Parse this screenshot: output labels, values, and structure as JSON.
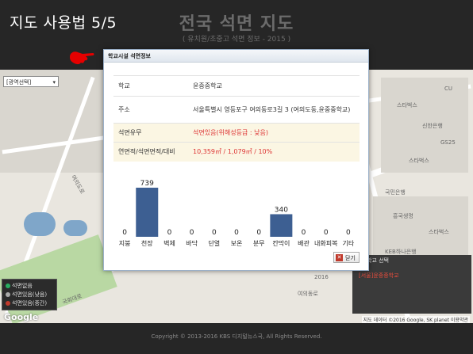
{
  "overlay_title": "지도 사용법 5/5",
  "header": {
    "title": "전국 석면 지도",
    "subtitle": "( 유치원/초중고 석면 정보 - 2015 )"
  },
  "map": {
    "region_select": "[광역선택]",
    "labels": [
      "스타벅스",
      "신한은행",
      "GS25",
      "스타벅스",
      "여의도로",
      "여의동로",
      "2016",
      "국회대로",
      "CU",
      "국민은행",
      "흥국생명",
      "스타벅스",
      "KEB하나은행"
    ],
    "credit": "지도 데이터 ©2016 Google, SK planet   이용약관",
    "google_logo": "Google"
  },
  "right_panel": {
    "header": "학교 선택",
    "item": "[서울]윤중중학교"
  },
  "legend": {
    "items": [
      {
        "label": "석면없음",
        "color": "#27ae60"
      },
      {
        "label": "석면있음(낮음)",
        "color": "#aaaaaa"
      },
      {
        "label": "석면있음(중간)",
        "color": "#c0392b"
      }
    ]
  },
  "dialog": {
    "title": "학교시설 석면정보",
    "rows": [
      {
        "key": "학교",
        "value": "윤중중학교",
        "highlight": false,
        "red": false
      },
      {
        "key": "주소",
        "value": "서울특별시 영등포구 여의동로3길 3 (여의도동,윤중중학교)",
        "highlight": false,
        "red": false
      },
      {
        "key": "석면유무",
        "value": "석면있음(위해성등급 : 낮음)",
        "highlight": true,
        "red": true
      },
      {
        "key": "연면적/석면면적/대비",
        "value": "10,359㎡ / 1,079㎡ / 10%",
        "highlight": true,
        "red": true
      }
    ],
    "close_label": "닫기"
  },
  "chart_data": {
    "type": "bar",
    "categories": [
      "지붕",
      "천장",
      "벽체",
      "바닥",
      "단열",
      "보온",
      "분무",
      "칸막이",
      "배관",
      "내화피복",
      "기타"
    ],
    "values": [
      0,
      739,
      0,
      0,
      0,
      0,
      0,
      340,
      0,
      0,
      0
    ],
    "bar_color": "#3d5f92",
    "title": "",
    "xlabel": "",
    "ylabel": ""
  },
  "footer": "Copyright © 2013-2016 KBS 디지털뉴스국, All Rights Reserved."
}
